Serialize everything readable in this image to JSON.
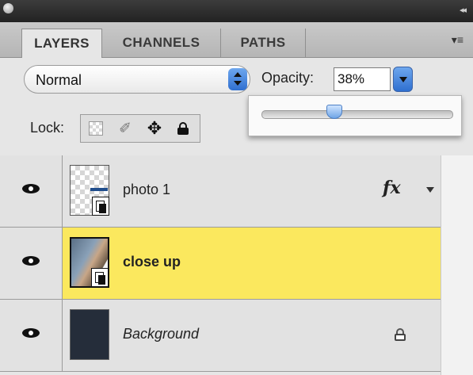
{
  "window": {
    "collapse_glyph": "◂◂"
  },
  "tabs": [
    {
      "label": "LAYERS",
      "active": true
    },
    {
      "label": "CHANNELS",
      "active": false
    },
    {
      "label": "PATHS",
      "active": false
    }
  ],
  "panel_menu_icon": "▾≡",
  "blend_mode": {
    "value": "Normal"
  },
  "opacity": {
    "label": "Opacity:",
    "value": "38%",
    "slider_fraction": 0.38
  },
  "lock": {
    "label": "Lock:",
    "position_glyph": "✥",
    "image_glyph": "✐"
  },
  "layers": [
    {
      "name": "photo 1",
      "visible": true,
      "selected": false,
      "has_fx": true,
      "fx_label": "fx"
    },
    {
      "name": "close up",
      "visible": true,
      "selected": true
    },
    {
      "name": "Background",
      "visible": true,
      "selected": false,
      "locked": true
    }
  ],
  "colors": {
    "selected_row": "#fbe85e",
    "accent_blue": "#2f6fd0"
  }
}
